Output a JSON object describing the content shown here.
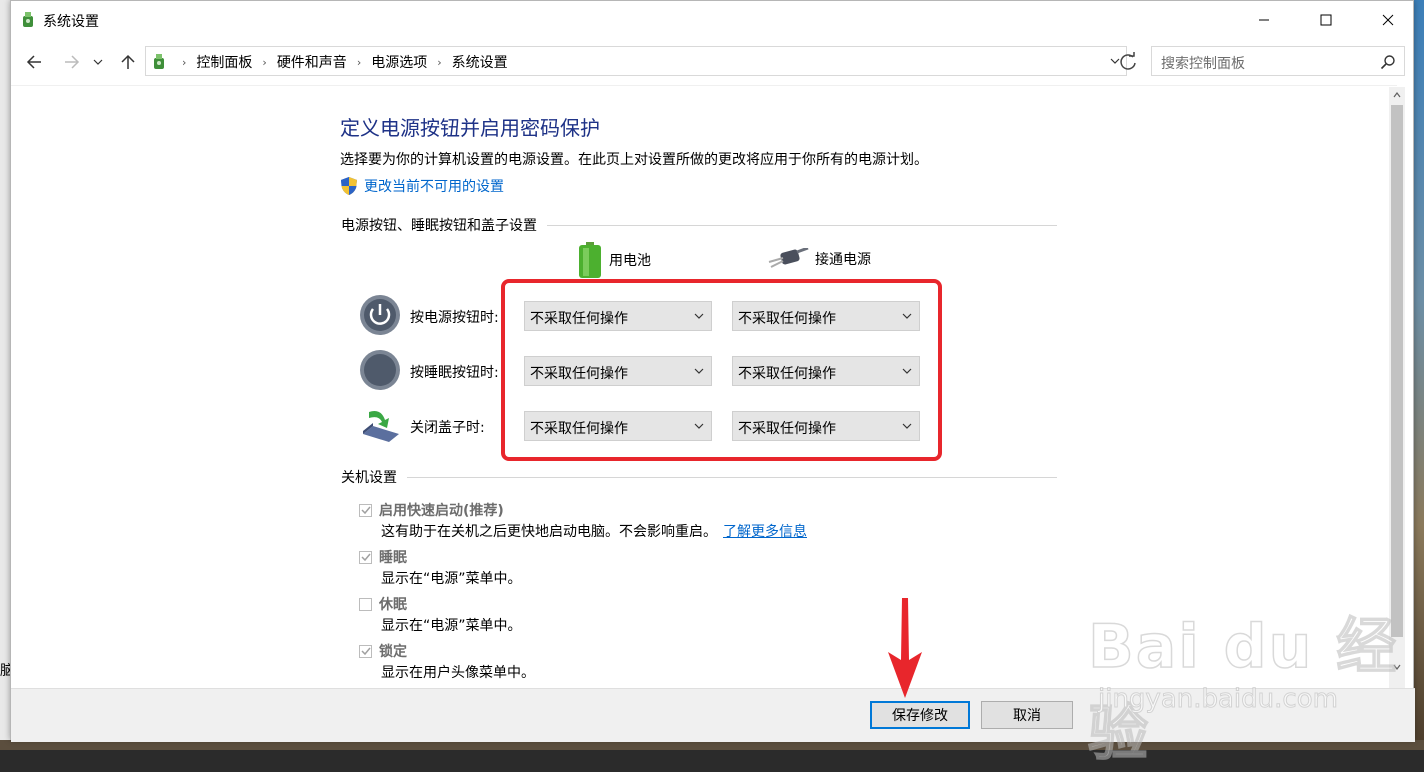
{
  "window": {
    "title": "系统设置"
  },
  "nav": {
    "breadcrumbs": [
      "控制面板",
      "硬件和声音",
      "电源选项",
      "系统设置"
    ],
    "search_placeholder": "搜索控制面板"
  },
  "page": {
    "title": "定义电源按钮并启用密码保护",
    "description": "选择要为你的计算机设置的电源设置。在此页上对设置所做的更改将应用于你所有的电源计划。",
    "change_link": "更改当前不可用的设置"
  },
  "buttons_section": {
    "heading": "电源按钮、睡眠按钮和盖子设置",
    "col_battery": "用电池",
    "col_plugged": "接通电源",
    "rows": [
      {
        "label": "按电源按钮时:",
        "battery": "不采取任何操作",
        "plugged": "不采取任何操作",
        "icon": "power-button-icon"
      },
      {
        "label": "按睡眠按钮时:",
        "battery": "不采取任何操作",
        "plugged": "不采取任何操作",
        "icon": "sleep-button-icon"
      },
      {
        "label": "关闭盖子时:",
        "battery": "不采取任何操作",
        "plugged": "不采取任何操作",
        "icon": "laptop-lid-icon"
      }
    ]
  },
  "shutdown_section": {
    "heading": "关机设置",
    "items": [
      {
        "label": "启用快速启动(推荐)",
        "checked": true,
        "desc": "这有助于在关机之后更快地启动电脑。不会影响重启。",
        "link": "了解更多信息"
      },
      {
        "label": "睡眠",
        "checked": true,
        "desc": "显示在“电源”菜单中。"
      },
      {
        "label": "休眠",
        "checked": false,
        "desc": "显示在“电源”菜单中。"
      },
      {
        "label": "锁定",
        "checked": true,
        "desc": "显示在用户头像菜单中。"
      }
    ]
  },
  "footer": {
    "save": "保存修改",
    "cancel": "取消"
  },
  "annotation": {
    "highlight_color": "#e8262c",
    "arrow_color": "#e8262c"
  },
  "watermark": {
    "logo": "Bai du 经验",
    "url": "jingyan.baidu.com"
  },
  "stray_text": "脑",
  "colors": {
    "title_blue": "#1e3287",
    "link_blue": "#0066cc",
    "accent": "#0078d7"
  }
}
